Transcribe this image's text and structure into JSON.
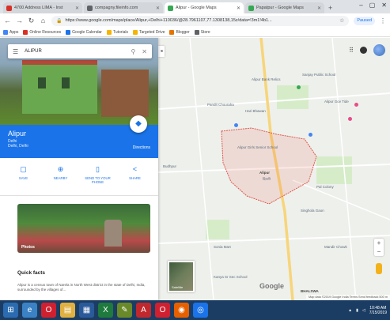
{
  "browser": {
    "tabs": [
      {
        "title": "4700 Address LIMA - Inst",
        "color": "#d93025",
        "active": false
      },
      {
        "title": "compagny.fileinfo.com",
        "color": "#5f6368",
        "active": false
      },
      {
        "title": "Alipur - Google Maps",
        "color": "#34a853",
        "active": true
      },
      {
        "title": "Papatpur - Google Maps",
        "color": "#34a853",
        "active": false
      }
    ],
    "new_tab": "+",
    "url": "https://www.google.com/maps/place/Alipur,+Delhi+110036/@28.7961107,77.1308138,15z/data=!3m1!4b1...",
    "profile": "Paused",
    "bookmarks": [
      {
        "label": "Apps",
        "color": "#4285f4"
      },
      {
        "label": "Online Resources",
        "color": "#d93025"
      },
      {
        "label": "Google Calendar",
        "color": "#1a73e8"
      },
      {
        "label": "Tutorials",
        "color": "#f4b400"
      },
      {
        "label": "Targeted Drive",
        "color": "#f4b400"
      },
      {
        "label": "Blogger",
        "color": "#e37400"
      },
      {
        "label": "Store",
        "color": "#5f6368"
      }
    ]
  },
  "panel": {
    "search_query": "ALIPUR",
    "place_name": "Alipur",
    "place_sub": "Delhi",
    "place_sub2": "Delhi, Delhi",
    "directions_label": "Directions",
    "actions": [
      {
        "label": "SAVE",
        "icon": "bookmark-icon",
        "glyph": "▢"
      },
      {
        "label": "NEARBY",
        "icon": "nearby-icon",
        "glyph": "⊕"
      },
      {
        "label": "SEND TO YOUR PHONE",
        "icon": "phone-icon",
        "glyph": "▯"
      },
      {
        "label": "SHARE",
        "icon": "share-icon",
        "glyph": "<"
      }
    ],
    "photos_label": "Photos",
    "quick_facts_title": "Quick facts",
    "quick_facts_text": "Alipur is a census town of Narela in North West district in the state of Delhi, India, surrounded by the villages of..."
  },
  "map": {
    "labels": [
      {
        "text": "Alipur Bank Relics",
        "dark": false
      },
      {
        "text": "Sanjay Public School",
        "dark": false
      },
      {
        "text": "Pandit Chouraha",
        "dark": false
      },
      {
        "text": "Hari Bhawan",
        "dark": false
      },
      {
        "text": "Alipur Gov Tide",
        "dark": false
      },
      {
        "text": "Alipur Girls Senior School",
        "dark": false
      },
      {
        "text": "Alipur",
        "dark": true
      },
      {
        "text": "दिल्ली",
        "dark": false
      },
      {
        "text": "Budhpur",
        "dark": false
      },
      {
        "text": "Pal Colony",
        "dark": false
      },
      {
        "text": "Sonia Mart",
        "dark": false
      },
      {
        "text": "Mandir Chowk",
        "dark": false
      },
      {
        "text": "BHALSWA",
        "dark": true
      },
      {
        "text": "Kanya Sr Sec School",
        "dark": false
      },
      {
        "text": "Singhola Gaon",
        "dark": false
      }
    ],
    "satellite_label": "Satellite",
    "google_logo": "Google",
    "attribution": "Map data ©2019 Google   India   Terms   Send feedback   500 m",
    "zoom_in": "+",
    "zoom_out": "−"
  },
  "taskbar": {
    "apps": [
      {
        "name": "start",
        "glyph": "⊞",
        "color": "#2b6cb0"
      },
      {
        "name": "ie",
        "glyph": "e",
        "color": "#3b82c4"
      },
      {
        "name": "opera",
        "glyph": "O",
        "color": "#d02030"
      },
      {
        "name": "explorer",
        "glyph": "▤",
        "color": "#e0b040"
      },
      {
        "name": "outlook",
        "glyph": "▦",
        "color": "#2a5a9a"
      },
      {
        "name": "excel",
        "glyph": "X",
        "color": "#1f7a3d"
      },
      {
        "name": "feather",
        "glyph": "✎",
        "color": "#6a8a2a"
      },
      {
        "name": "acrobat",
        "glyph": "A",
        "color": "#c0282d"
      },
      {
        "name": "opera2",
        "glyph": "O",
        "color": "#d02030"
      },
      {
        "name": "firefox",
        "glyph": "◉",
        "color": "#e66000"
      },
      {
        "name": "chrome",
        "glyph": "◎",
        "color": "#1a73e8"
      }
    ],
    "clock_time": "10:48 AM",
    "clock_date": "7/15/2019"
  }
}
